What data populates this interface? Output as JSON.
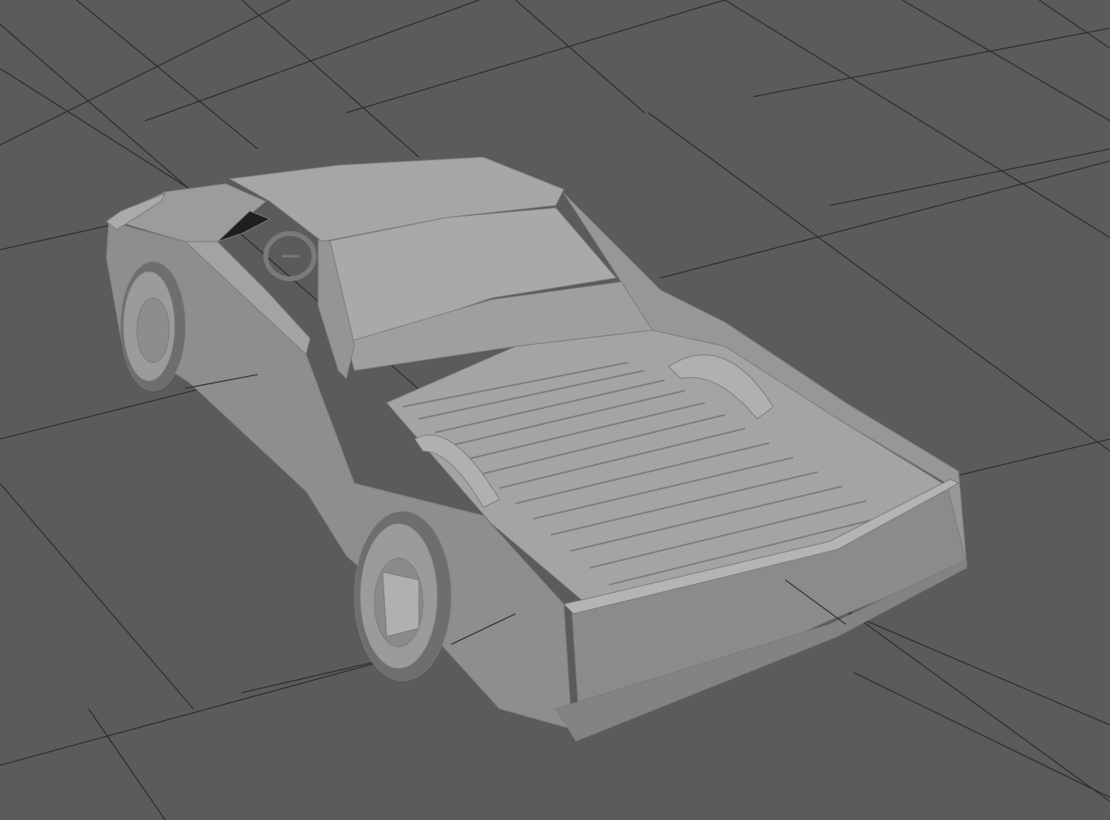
{
  "viewport": {
    "background_color": "#5b5b5b",
    "grid_color": "#2c2c2c",
    "grid_visible": true,
    "shading": "untextured-gray"
  },
  "scene": {
    "model": "pickup-truck",
    "model_base_color": "#9a9a9a",
    "wheel_count_visible": 2
  }
}
